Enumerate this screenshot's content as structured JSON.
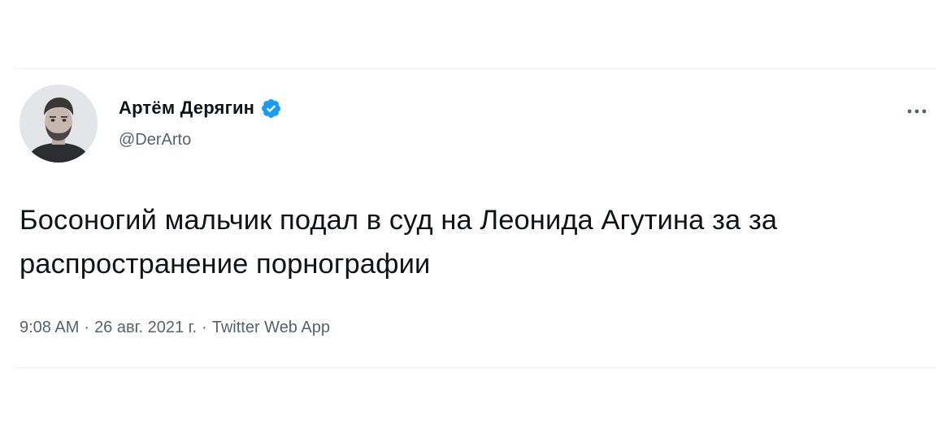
{
  "tweet": {
    "author": {
      "display_name": "Артём Дерягин",
      "handle": "@DerArto",
      "verified": true,
      "verified_color": "#1d9bf0"
    },
    "text": "Босоногий мальчик подал в суд на Леонида Агутина за за распространение порнографии",
    "meta": {
      "time": "9:08 AM",
      "separator": "·",
      "date": "26 авг. 2021 г.",
      "source": "Twitter Web App"
    },
    "icons": {
      "more": "more-horizontal-icon",
      "verified": "verified-badge-icon"
    }
  }
}
